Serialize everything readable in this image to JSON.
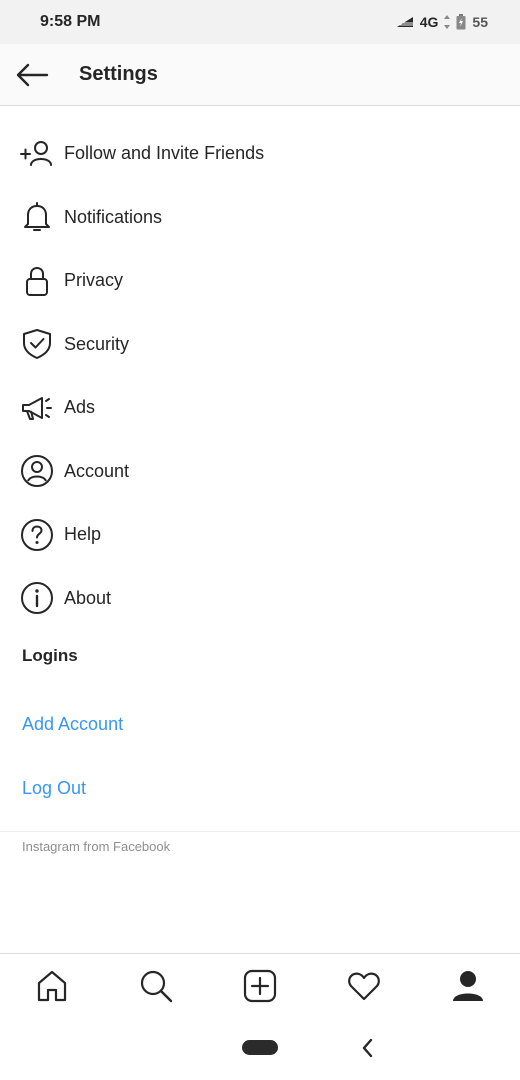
{
  "status_bar": {
    "time": "9:58 PM",
    "network": "4G",
    "battery": "55"
  },
  "header": {
    "title": "Settings",
    "back_icon": "arrow-left-icon"
  },
  "menu": {
    "items": [
      {
        "label": "Follow and Invite Friends",
        "icon": "add-person-icon"
      },
      {
        "label": "Notifications",
        "icon": "bell-icon"
      },
      {
        "label": "Privacy",
        "icon": "lock-icon"
      },
      {
        "label": "Security",
        "icon": "shield-check-icon"
      },
      {
        "label": "Ads",
        "icon": "megaphone-icon"
      },
      {
        "label": "Account",
        "icon": "user-circle-icon"
      },
      {
        "label": "Help",
        "icon": "question-circle-icon"
      },
      {
        "label": "About",
        "icon": "info-circle-icon"
      }
    ]
  },
  "logins": {
    "title": "Logins",
    "add_account": "Add Account",
    "log_out": "Log Out"
  },
  "footer": {
    "note": "Instagram from Facebook"
  },
  "tabbar": {
    "tabs": [
      "home-icon",
      "search-icon",
      "new-post-icon",
      "heart-icon",
      "profile-icon"
    ]
  },
  "colors": {
    "link": "#3897f0",
    "text": "#262626",
    "muted": "#8e8e8e"
  }
}
